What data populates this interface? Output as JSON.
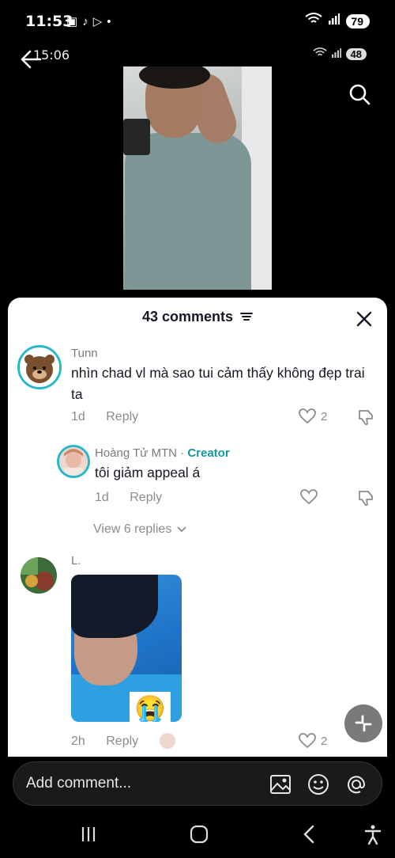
{
  "status_bar": {
    "time": "11:53",
    "battery": "79"
  },
  "inner_status": {
    "time": "15:06",
    "battery": "48"
  },
  "comments_sheet": {
    "title": "43 comments",
    "comments": [
      {
        "username": "Tunn",
        "text": "nhìn chad vl mà sao tui cảm thấy không đẹp trai ta",
        "age": "1d",
        "reply_label": "Reply",
        "likes": "2"
      },
      {
        "username": "Hoàng Tử MTN",
        "badge": "Creator",
        "separator": "·",
        "text": "tôi giảm appeal á",
        "age": "1d",
        "reply_label": "Reply"
      },
      {
        "username": "L.",
        "age": "2h",
        "reply_label": "Reply",
        "likes": "2"
      }
    ],
    "view_replies": "View 6 replies"
  },
  "input": {
    "placeholder": "Add comment..."
  },
  "colors": {
    "creator_accent": "#1596a3",
    "sheet_bg": "#ffffff",
    "app_bg": "#000000"
  },
  "icons": [
    "back-arrow-icon",
    "search-icon",
    "close-icon",
    "filter-icon",
    "heart-icon",
    "dislike-icon",
    "chevron-down-icon",
    "image-icon",
    "emoji-icon",
    "mention-icon",
    "collapse-icon",
    "recent-apps-icon",
    "home-icon",
    "back-icon",
    "accessibility-icon"
  ]
}
